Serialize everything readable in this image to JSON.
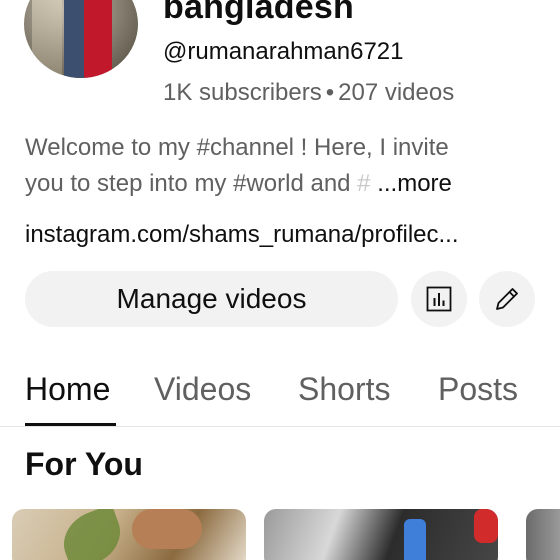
{
  "channel": {
    "name": "bangladesh",
    "handle": "@rumanarahman6721",
    "subscribers": "1K subscribers",
    "separator": "•",
    "videos": "207 videos",
    "description_line1": "Welcome to my #channel ! Here, I invite",
    "description_line2": "you to step into my #world  and",
    "description_fade": " #",
    "more_label": "...more",
    "link": "instagram.com/shams_rumana/profilec..."
  },
  "actions": {
    "manage_label": "Manage videos",
    "stats_icon": "analytics-icon",
    "edit_icon": "pencil-icon"
  },
  "tabs": [
    {
      "label": "Home",
      "active": true
    },
    {
      "label": "Videos",
      "active": false
    },
    {
      "label": "Shorts",
      "active": false
    },
    {
      "label": "Posts",
      "active": false
    }
  ],
  "section": {
    "title": "For You"
  }
}
